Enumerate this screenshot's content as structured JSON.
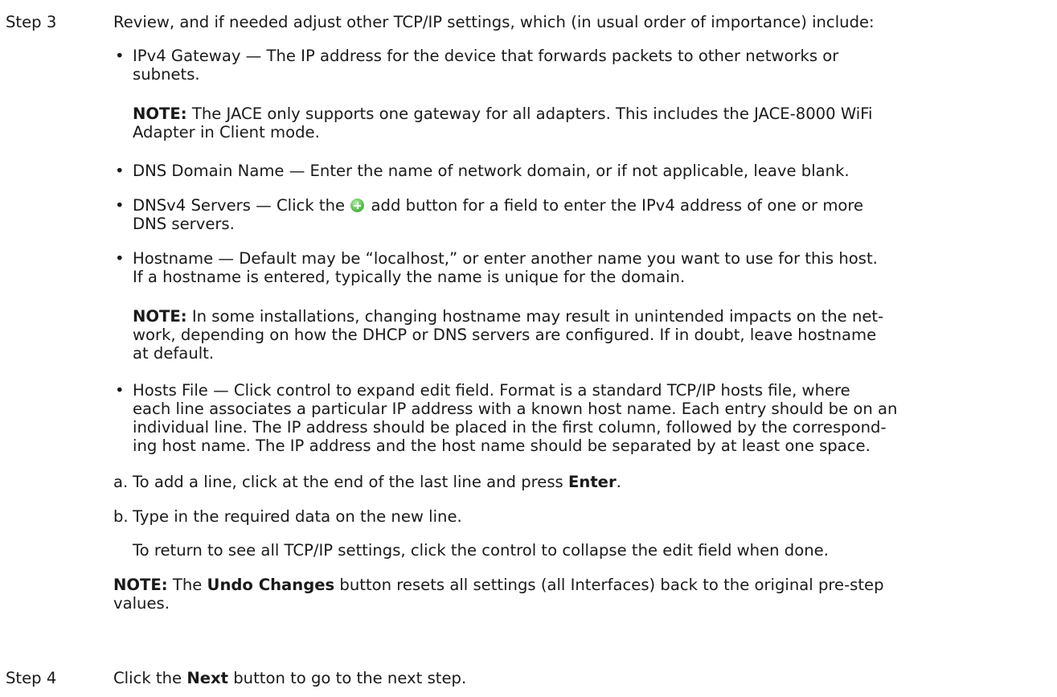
{
  "step3": {
    "label": "Step 3",
    "intro": "Review, and if needed adjust other TCP/IP settings, which (in usual order of importance) include:"
  },
  "ipv4_gateway": {
    "line1": "IPv4 Gateway — The IP address for the device that forwards packets to other networks or",
    "line2": "subnets."
  },
  "note1": {
    "label": "NOTE:",
    "line1": " The JACE only supports one gateway for all adapters. This includes the JACE-8000 WiFi",
    "line2": "Adapter in Client mode."
  },
  "dns_domain": {
    "text": "DNS Domain Name —  Enter the name of network domain, or if not applicable, leave blank."
  },
  "dnsv4_servers": {
    "text_before": "DNSv4 Servers —  Click the ",
    "text_after": " add button for a field to enter the IPv4 address of one or more",
    "line2": "DNS servers.",
    "icon": "add-icon"
  },
  "hostname": {
    "line1": "Hostname — Default may be “localhost,” or enter another name you want to use for this host.",
    "line2": "If a hostname is entered, typically the name is unique for the domain."
  },
  "note2": {
    "label": "NOTE:",
    "line1": " In some installations, changing hostname may result in unintended impacts on the net-",
    "line2": "work, depending on how the DHCP or DNS servers are configured. If in doubt, leave hostname",
    "line3": "at default."
  },
  "hosts_file": {
    "line1": "Hosts File — Click control to expand edit field. Format is a standard TCP/IP hosts file, where",
    "line2": "each line associates a particular IP address with a known host name. Each entry should be on an",
    "line3": "individual line. The IP address should be placed in the first column, followed by the correspond-",
    "line4": "ing host name. The IP address and the host name should be separated by at least one space."
  },
  "substep_a": {
    "marker": "a.",
    "text_before": "To add a line, click at the end of the last line and press ",
    "key": "Enter",
    "text_after": "."
  },
  "substep_b": {
    "marker": "b.",
    "text": "Type in the required data on the new line."
  },
  "return_text": "To return to see all TCP/IP settings, click the control to collapse the edit field when done.",
  "note3": {
    "label": "NOTE:",
    "text_before": " The ",
    "button": "Undo Changes",
    "text_after": " button resets all settings (all Interfaces) back to the original pre-step",
    "line2": "values."
  },
  "step4": {
    "label": "Step 4",
    "text_before": "Click the ",
    "button": "Next",
    "text_after": " button to go to the next step."
  },
  "bullet_char": "•"
}
